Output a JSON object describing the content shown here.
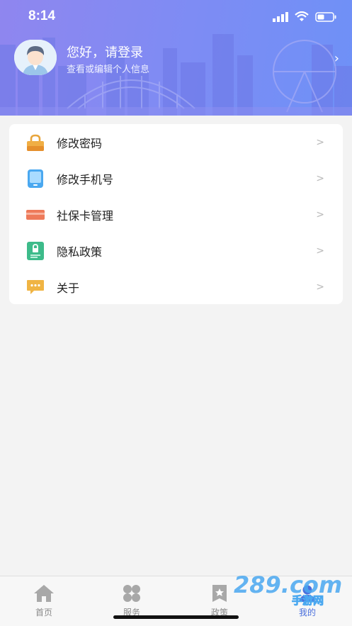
{
  "status": {
    "time": "8:14"
  },
  "profile": {
    "greeting": "您好，请登录",
    "subtitle": "查看或编辑个人信息"
  },
  "menu": {
    "items": [
      {
        "label": "修改密码",
        "icon": "lock-icon"
      },
      {
        "label": "修改手机号",
        "icon": "phone-icon"
      },
      {
        "label": "社保卡管理",
        "icon": "card-icon"
      },
      {
        "label": "隐私政策",
        "icon": "privacy-icon"
      },
      {
        "label": "关于",
        "icon": "chat-icon"
      }
    ],
    "chevron": ">"
  },
  "tabs": [
    {
      "label": "首页",
      "icon": "home-icon"
    },
    {
      "label": "服务",
      "icon": "service-icon"
    },
    {
      "label": "政策",
      "icon": "policy-icon"
    },
    {
      "label": "我的",
      "icon": "profile-icon",
      "active": true
    }
  ],
  "watermark": {
    "text": "289.com",
    "subtext": "手游网"
  },
  "colors": {
    "accent": "#4a6fdc",
    "header_start": "#8f86ef",
    "header_end": "#6e91f7",
    "lock": "#e8a53c",
    "phone": "#4aa8f0",
    "card": "#ee7a5a",
    "privacy": "#3dbb8a",
    "chat": "#f0b443"
  }
}
